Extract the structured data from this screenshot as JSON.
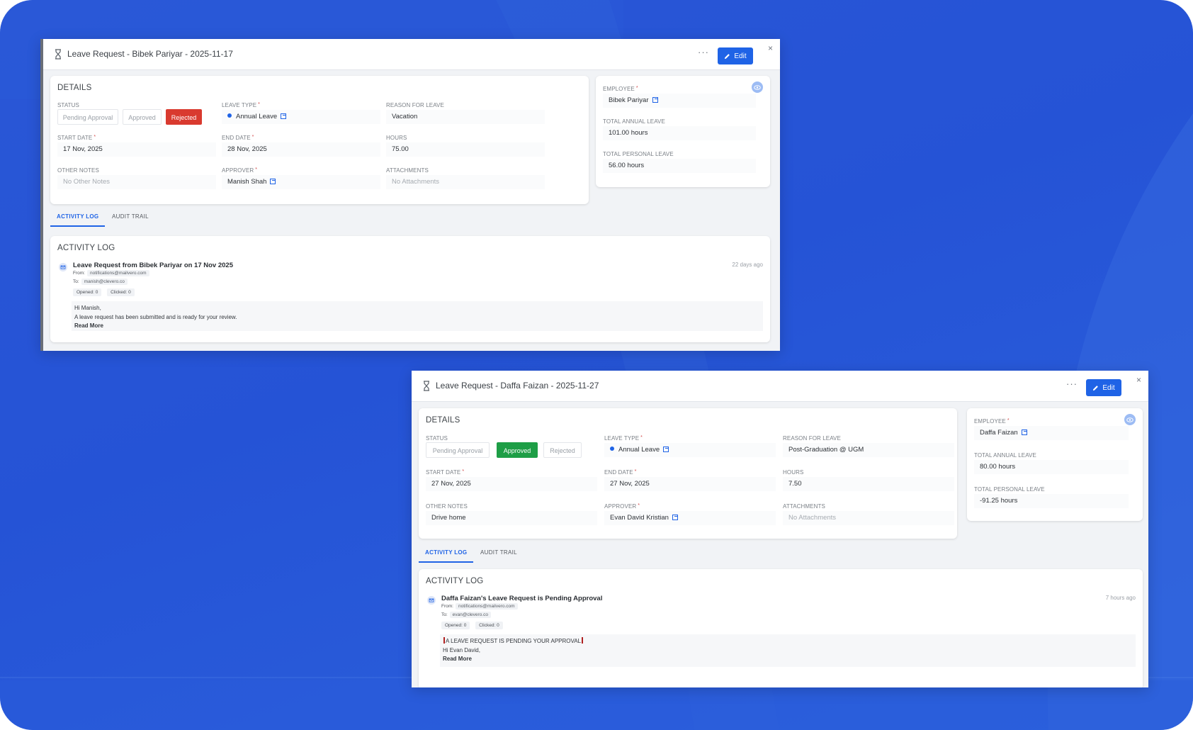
{
  "window1": {
    "title": "Leave Request - Bibek Pariyar - 2025-11-17",
    "more_label": "···",
    "edit_label": "Edit",
    "close_label": "×",
    "details_title": "DETAILS",
    "status_label": "STATUS",
    "status_options": [
      "Pending Approval",
      "Approved",
      "Rejected"
    ],
    "status_selected": "Rejected",
    "leave_type_label": "LEAVE TYPE",
    "leave_type": "Annual Leave",
    "reason_label": "REASON FOR LEAVE",
    "reason": "Vacation",
    "start_date_label": "START DATE",
    "start_date": "17 Nov, 2025",
    "end_date_label": "END DATE",
    "end_date": "28 Nov, 2025",
    "hours_label": "HOURS",
    "hours": "75.00",
    "notes_label": "OTHER NOTES",
    "notes": "No Other Notes",
    "approver_label": "APPROVER",
    "approver": "Manish Shah",
    "attachments_label": "ATTACHMENTS",
    "attachments": "No Attachments",
    "employee_label": "EMPLOYEE",
    "employee": "Bibek Pariyar",
    "annual_label": "TOTAL ANNUAL LEAVE",
    "annual": "101.00 hours",
    "personal_label": "TOTAL PERSONAL LEAVE",
    "personal": "56.00 hours",
    "tabs": [
      "ACTIVITY LOG",
      "AUDIT TRAIL"
    ],
    "activity_title": "ACTIVITY LOG",
    "log": {
      "subject": "Leave Request from Bibek Pariyar on 17 Nov 2025",
      "time": "22 days ago",
      "from_label": "From:",
      "from": "notifications@mailvero.com",
      "to_label": "To:",
      "to": "manish@clevero.co",
      "opened": "Opened: 0",
      "clicked": "Clicked: 0",
      "line1": "Hi Manish,",
      "line2": "A leave request has been submitted and is ready for your review.",
      "read_more": "Read More"
    }
  },
  "window2": {
    "title": "Leave Request - Daffa Faizan - 2025-11-27",
    "more_label": "···",
    "edit_label": "Edit",
    "close_label": "×",
    "details_title": "DETAILS",
    "status_label": "STATUS",
    "status_options": [
      "Pending Approval",
      "Approved",
      "Rejected"
    ],
    "status_selected": "Approved",
    "leave_type_label": "LEAVE TYPE",
    "leave_type": "Annual Leave",
    "reason_label": "REASON FOR LEAVE",
    "reason": "Post-Graduation @ UGM",
    "start_date_label": "START DATE",
    "start_date": "27 Nov, 2025",
    "end_date_label": "END DATE",
    "end_date": "27 Nov, 2025",
    "hours_label": "HOURS",
    "hours": "7.50",
    "notes_label": "OTHER NOTES",
    "notes": "Drive home",
    "approver_label": "APPROVER",
    "approver": "Evan David Kristian",
    "attachments_label": "ATTACHMENTS",
    "attachments": "No Attachments",
    "employee_label": "EMPLOYEE",
    "employee": "Daffa Faizan",
    "annual_label": "TOTAL ANNUAL LEAVE",
    "annual": "80.00 hours",
    "personal_label": "TOTAL PERSONAL LEAVE",
    "personal": "-91.25 hours",
    "tabs": [
      "ACTIVITY LOG",
      "AUDIT TRAIL"
    ],
    "activity_title": "ACTIVITY LOG",
    "log": {
      "subject": "Daffa Faizan's Leave Request is Pending Approval",
      "time": "7 hours ago",
      "from_label": "From:",
      "from": "notifications@mailvero.com",
      "to_label": "To:",
      "to": "evan@clevero.co",
      "opened": "Opened: 0",
      "clicked": "Clicked: 0",
      "line1": "A LEAVE REQUEST IS PENDING YOUR APPROVAL",
      "line2": "Hi Evan David,",
      "read_more": "Read More"
    }
  },
  "colors": {
    "background": "#2553d6",
    "primary": "#1f63e6",
    "rejected": "#d93a2f",
    "approved": "#1e9e46"
  },
  "icons": [
    "leave-request-icon",
    "edit-pencil-icon",
    "external-link-icon",
    "eye-icon",
    "email-icon"
  ]
}
